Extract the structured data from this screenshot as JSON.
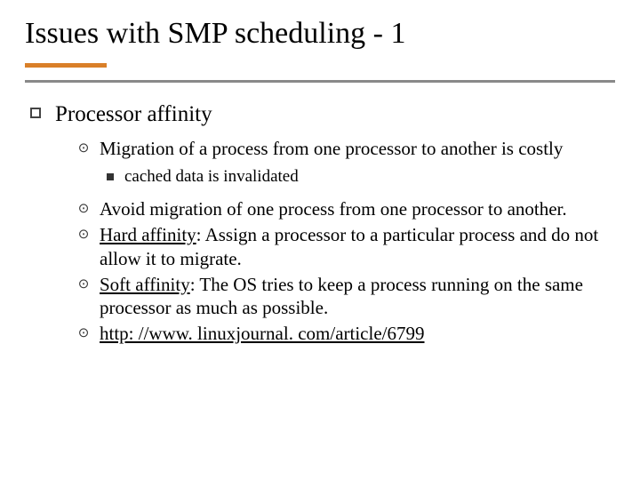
{
  "title": "Issues with SMP scheduling - 1",
  "lvl1": {
    "text": "Processor affinity"
  },
  "lvl2": {
    "item0": "Migration of a process from one processor to another is costly",
    "item1": "Avoid migration of one process from one processor to another.",
    "item2_label": "Hard affinity",
    "item2_rest": ": Assign a processor to a particular process and do not allow it to migrate.",
    "item3_label": "Soft affinity",
    "item3_rest": ": The OS tries to keep a process running on the same processor as much as possible.",
    "item4_link": "http: //www. linuxjournal. com/article/6799"
  },
  "lvl3": {
    "item0": "cached data is invalidated"
  }
}
